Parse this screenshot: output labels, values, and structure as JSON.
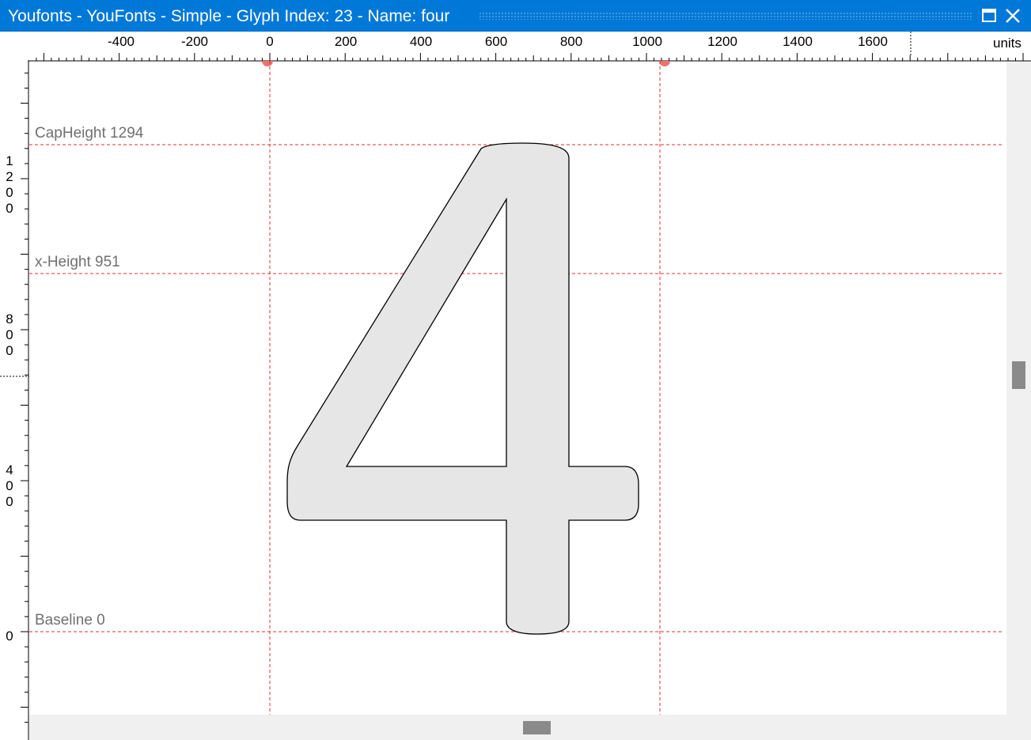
{
  "window": {
    "title": "Youfonts - YouFonts - Simple - Glyph Index: 23 - Name: four",
    "maximize_icon": "maximize-icon",
    "close_icon": "close-icon"
  },
  "ruler": {
    "top_labels": [
      "-400",
      "-200",
      "0",
      "200",
      "400",
      "600",
      "800",
      "1000",
      "1200",
      "1400",
      "1600"
    ],
    "units_label": "units",
    "left_labels": [
      "1\n2\n0\n0",
      "8\n0\n0",
      "4\n0\n0",
      "0"
    ]
  },
  "metrics": {
    "cap_height_label": "CapHeight 1294",
    "x_height_label": "x-Height 951",
    "baseline_label": "Baseline 0"
  },
  "glyph": {
    "index": 23,
    "name": "four",
    "fill_color": "#e6e6e6",
    "outline_color": "#000000"
  },
  "colors": {
    "title_bar": "#0078d7",
    "guide_line": "#e03030",
    "side_bearing_marker": "#f07070"
  }
}
